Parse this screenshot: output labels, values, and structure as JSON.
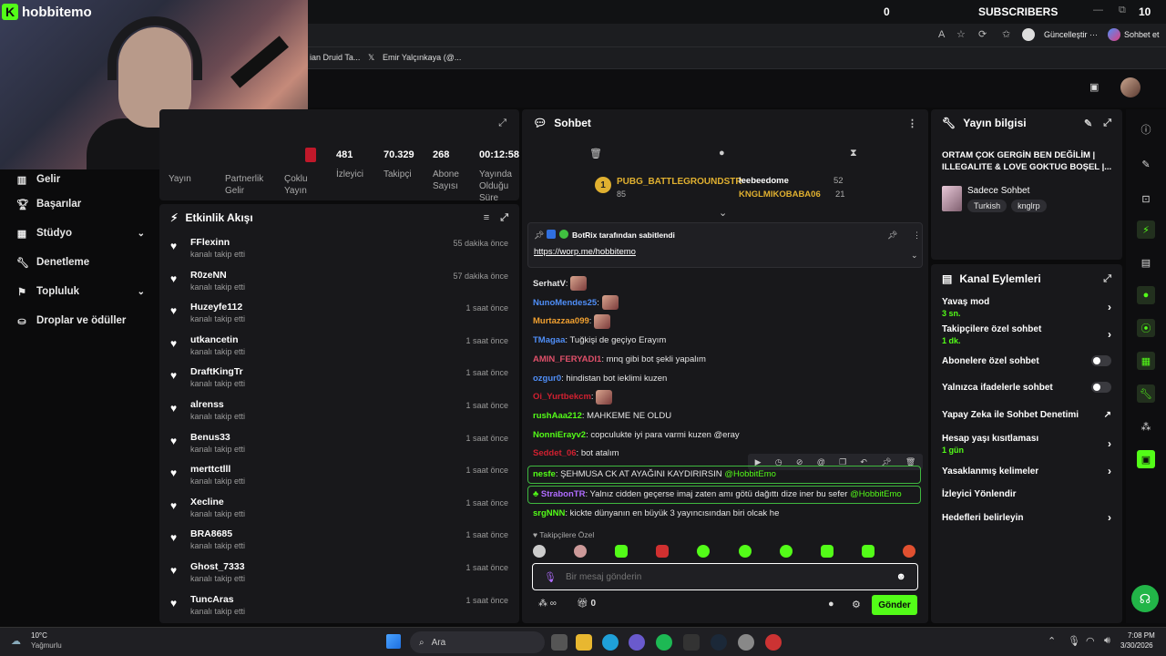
{
  "top": {
    "count": "0",
    "subscribers": "SUBSCRIBERS",
    "right_count": "10"
  },
  "browser": {
    "update_btn": "Güncelleştir ···",
    "chat_btn": "Sohbet et",
    "bookmarks": [
      "ian Druid Ta...",
      "Emir Yalçınkaya (@..."
    ]
  },
  "logo": {
    "brand": "hobbitemo"
  },
  "sidebar": {
    "items": [
      {
        "label": "Gelir",
        "icon": "chart-icon"
      },
      {
        "label": "Başarılar",
        "icon": "trophy-icon"
      },
      {
        "label": "Stüdyo",
        "icon": "studio-icon",
        "expand": true
      },
      {
        "label": "Denetleme",
        "icon": "wrench-icon"
      },
      {
        "label": "Topluluk",
        "icon": "community-icon",
        "expand": true
      },
      {
        "label": "Droplar ve ödüller",
        "icon": "drops-icon"
      }
    ]
  },
  "stats": {
    "left_labels": [
      "Yayın",
      "Partnerlik Gelir",
      "Çoklu Yayın"
    ],
    "items": [
      {
        "value": "481",
        "label": "İzleyici"
      },
      {
        "value": "70.329",
        "label": "Takipçi"
      },
      {
        "value": "268",
        "label": "Abone Sayısı"
      },
      {
        "value": "00:12:58",
        "label": "Yayında Olduğu Süre"
      }
    ]
  },
  "feed": {
    "title": "Etkinlik Akışı",
    "subtitle": "kanalı takip etti",
    "rows": [
      {
        "name": "FFlexinn",
        "time": "55 dakika önce"
      },
      {
        "name": "R0zeNN",
        "time": "57 dakika önce"
      },
      {
        "name": "Huzeyfe112",
        "time": "1 saat önce"
      },
      {
        "name": "utkancetin",
        "time": "1 saat önce"
      },
      {
        "name": "DraftKingTr",
        "time": "1 saat önce"
      },
      {
        "name": "alrenss",
        "time": "1 saat önce"
      },
      {
        "name": "Benus33",
        "time": "1 saat önce"
      },
      {
        "name": "merttctlll",
        "time": "1 saat önce"
      },
      {
        "name": "Xecline",
        "time": "1 saat önce"
      },
      {
        "name": "BRA8685",
        "time": "1 saat önce"
      },
      {
        "name": "Ghost_7333",
        "time": "1 saat önce"
      },
      {
        "name": "TuncAras",
        "time": "1 saat önce"
      }
    ]
  },
  "chat": {
    "title": "Sohbet",
    "leader": {
      "name": "PUBG_BATTLEGROUNDSTR",
      "score": "85"
    },
    "top2": [
      {
        "name": "leebeedome",
        "score": "52"
      },
      {
        "name": "KNGLMIKOBABA06",
        "score": "21"
      }
    ],
    "pinned_by": "BotRix tarafından sabitlendi",
    "pinned_link": "https://worp.me/hobbitemo",
    "messages": [
      {
        "user": "SerhatV",
        "color": "#e6e6e6",
        "text": "",
        "emote": true
      },
      {
        "user": "NunoMendes25",
        "color": "#4f8ef7",
        "text": "",
        "emote": true
      },
      {
        "user": "Murtazzaa099",
        "color": "#f0a030",
        "text": "",
        "emote": true
      },
      {
        "user": "TMagaa",
        "color": "#4f8ef7",
        "text": "Tuğkişi de geçiyo Erayım",
        "emote": false
      },
      {
        "user": "AMIN_FERYADI1",
        "color": "#e0506a",
        "text": "mnq gibi bot şekli yapalım",
        "emote": false
      },
      {
        "user": "ozgur0",
        "color": "#4f8ef7",
        "text": "hindistan bot ieklimi kuzen",
        "emote": false
      },
      {
        "user": "Oi_Yurtbekcm",
        "color": "#d02030",
        "text": "",
        "emote": true
      },
      {
        "user": "rushAaa212",
        "color": "#53fc18",
        "text": "MAHKEME NE OLDU",
        "emote": false
      },
      {
        "user": "NonniErayv2",
        "color": "#53fc18",
        "text": "copculukte iyi para varmi kuzen @eray",
        "emote": false
      },
      {
        "user": "Seddet_06",
        "color": "#d02030",
        "text": "bot atalım",
        "emote": false
      }
    ],
    "hl1": {
      "user": "nesfe",
      "text": "ŞEHMUSA CK AT AYAĞINI KAYDIRIRSIN",
      "mention": "@HobbitEmo"
    },
    "hl2": {
      "user": "StrabonTR",
      "text": "Yalnız cidden geçerse imaj zaten amı götü dağıttı dize iner bu sefer",
      "mention": "@HobbitEmo"
    },
    "last": {
      "user": "srgNNN",
      "text": "kickte dünyanın en büyük 3 yayıncısından biri olcak he"
    },
    "followers_only": "Takipçilere Özel",
    "placeholder": "Bir mesaj gönderin",
    "send": "Gönder",
    "footer_count": "0"
  },
  "info": {
    "title": "Yayın bilgisi",
    "stream_title": "ORTAM ÇOK GERGİN BEN DEĞİLİM | ILLEGALITE & LOVE GOKTUG BOŞEL |...",
    "category": "Sadece Sohbet",
    "tags": [
      "Turkish",
      "knglrp"
    ]
  },
  "actions": {
    "title": "Kanal Eylemleri",
    "items": [
      {
        "label": "Yavaş mod",
        "sub": "3 sn.",
        "kind": "arrow"
      },
      {
        "label": "Takipçilere özel sohbet",
        "sub": "1 dk.",
        "kind": "arrow"
      },
      {
        "label": "Abonelere özel sohbet",
        "sub": "",
        "kind": "toggle"
      },
      {
        "label": "Yalnızca ifadelerle sohbet",
        "sub": "",
        "kind": "toggle"
      },
      {
        "label": "Yapay Zeka ile Sohbet Denetimi",
        "sub": "",
        "kind": "ext"
      },
      {
        "label": "Hesap yaşı kısıtlaması",
        "sub": "1 gün",
        "kind": "arrow"
      },
      {
        "label": "Yasaklanmış kelimeler",
        "sub": "",
        "kind": "arrow"
      },
      {
        "label": "İzleyici Yönlendir",
        "sub": "",
        "kind": "none"
      },
      {
        "label": "Hedefleri belirleyin",
        "sub": "",
        "kind": "arrow"
      }
    ]
  },
  "taskbar": {
    "temp": "10°C",
    "weather": "Yağmurlu",
    "search": "Ara",
    "time": "7:08 PM",
    "date": "3/30/2026"
  }
}
